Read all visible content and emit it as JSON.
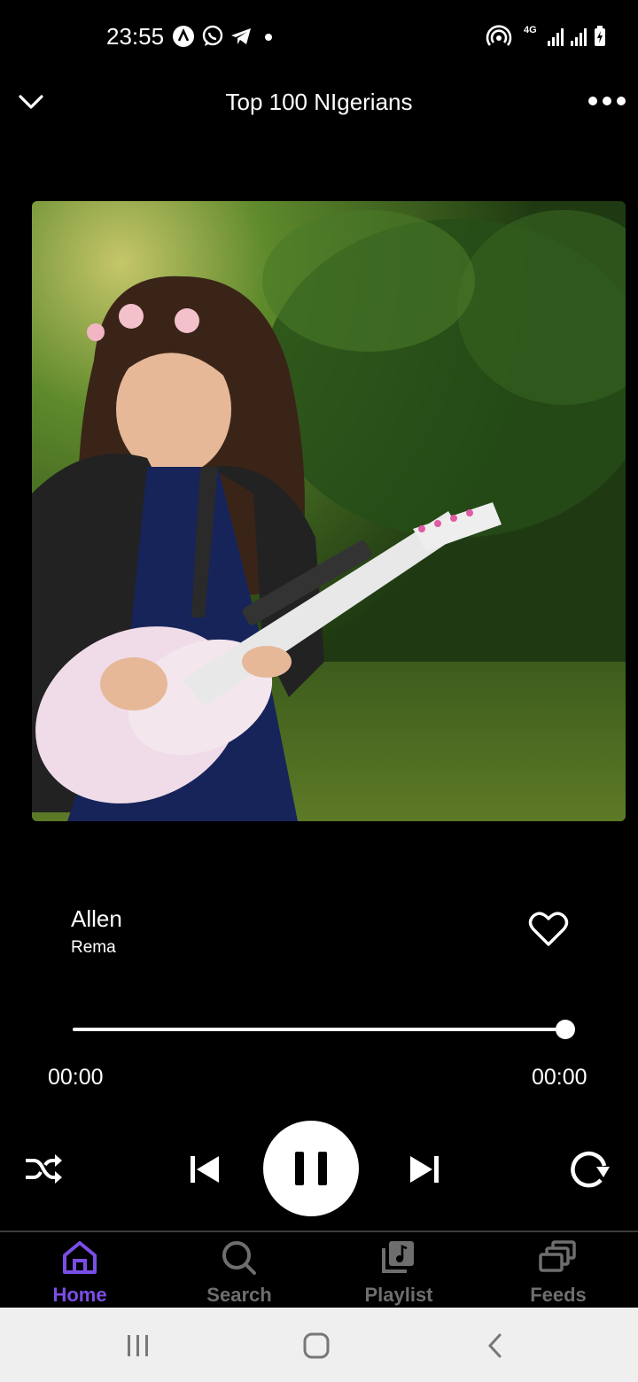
{
  "status_bar": {
    "time": "23:55",
    "network_label": "4G"
  },
  "header": {
    "title": "Top 100 NIgerians",
    "back_icon": "chevron-down-icon",
    "menu_icon": "more-horizontal-icon"
  },
  "track": {
    "title": "Allen",
    "artist": "Rema",
    "progress_fraction": 1.0,
    "elapsed": "00:00",
    "duration": "00:00",
    "liked": false
  },
  "controls": {
    "shuffle_icon": "shuffle-icon",
    "previous_icon": "skip-previous-icon",
    "play_state": "playing",
    "next_icon": "skip-next-icon",
    "repeat_icon": "repeat-icon"
  },
  "bottom_nav": {
    "items": [
      {
        "label": "Home",
        "icon": "home-icon",
        "active": true
      },
      {
        "label": "Search",
        "icon": "search-icon",
        "active": false
      },
      {
        "label": "Playlist",
        "icon": "playlist-icon",
        "active": false
      },
      {
        "label": "Feeds",
        "icon": "feeds-icon",
        "active": false
      }
    ]
  },
  "colors": {
    "accent": "#7a4ee6",
    "background": "#000000",
    "inactive": "#6e6e6e"
  }
}
